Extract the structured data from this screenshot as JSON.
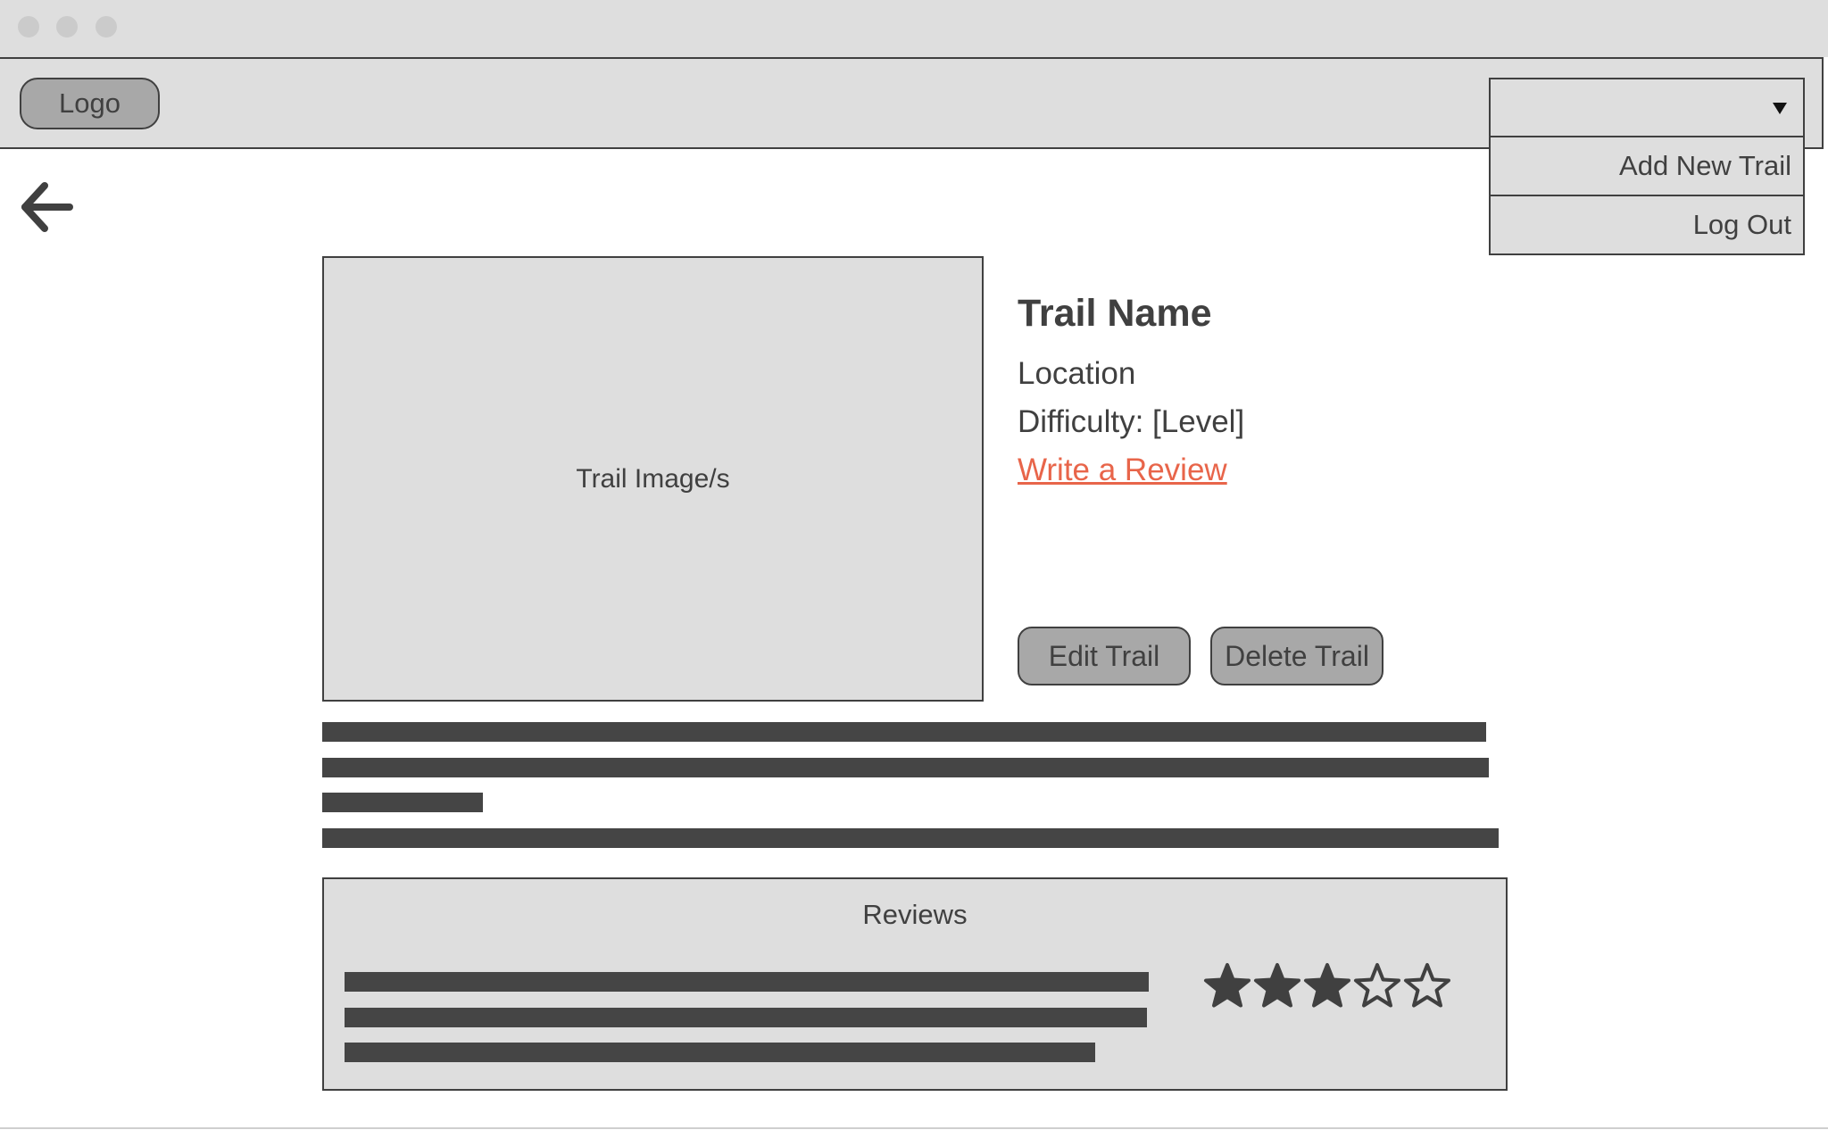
{
  "header": {
    "logo_label": "Logo",
    "dropdown_value": ""
  },
  "menu": {
    "items": [
      {
        "label": "Add New Trail"
      },
      {
        "label": "Log Out"
      }
    ]
  },
  "trail": {
    "image_placeholder": "Trail Image/s",
    "name": "Trail Name",
    "location": "Location",
    "difficulty": "Difficulty: [Level]",
    "review_link": "Write a Review",
    "edit_label": "Edit Trail",
    "delete_label": "Delete Trail"
  },
  "reviews": {
    "title": "Reviews",
    "rating": 3,
    "max_rating": 5
  },
  "colors": {
    "chrome": "#dedede",
    "button": "#a8a8a8",
    "text": "#404040",
    "link": "#e8654a",
    "placeholder_bar": "#454545"
  }
}
